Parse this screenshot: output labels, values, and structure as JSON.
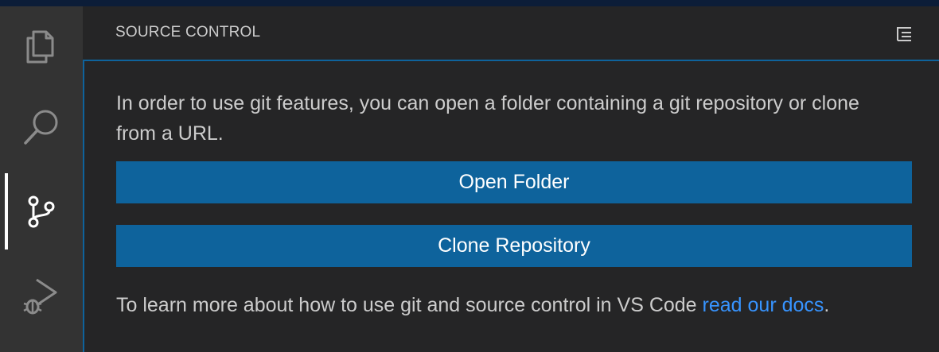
{
  "sidebar": {
    "title": "SOURCE CONTROL",
    "header_action_icon": "view-as-tree-icon"
  },
  "activity_bar": {
    "items": [
      {
        "icon": "files-icon",
        "active": false
      },
      {
        "icon": "search-icon",
        "active": false
      },
      {
        "icon": "source-control-icon",
        "active": true
      },
      {
        "icon": "run-debug-icon",
        "active": false
      }
    ]
  },
  "welcome": {
    "message": "In order to use git features, you can open a folder containing a git repository or clone from a URL.",
    "open_folder_label": "Open Folder",
    "clone_repository_label": "Clone Repository",
    "docs_prefix": "To learn more about how to use git and source control in VS Code ",
    "docs_link": "read our docs",
    "docs_suffix": "."
  },
  "colors": {
    "button_background": "#0e639c",
    "link": "#3794ff",
    "sidebar_background": "#252526",
    "activity_bar_background": "#333333"
  }
}
